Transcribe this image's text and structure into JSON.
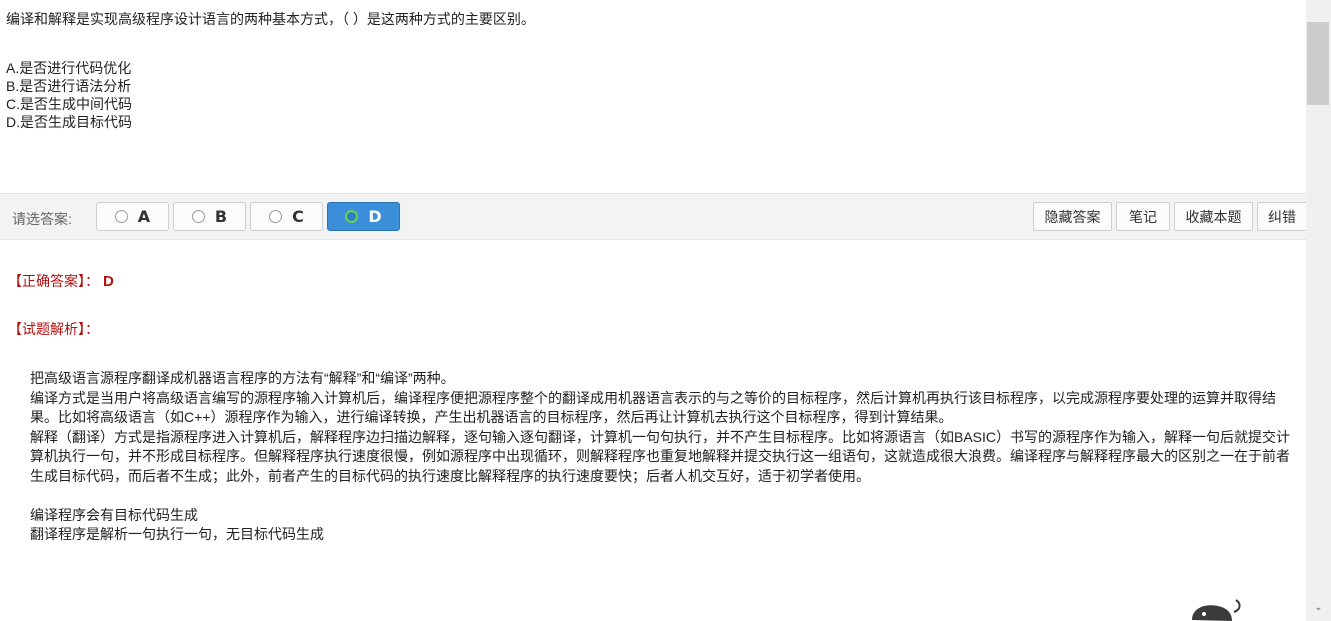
{
  "question": {
    "text": "编译和解释是实现高级程序设计语言的两种基本方式，（ ）是这两种方式的主要区别。",
    "options": [
      "A.是否进行代码优化",
      "B.是否进行语法分析",
      "C.是否生成中间代码",
      "D.是否生成目标代码"
    ]
  },
  "answer_bar": {
    "prompt": "请选答案:",
    "choices": [
      "A",
      "B",
      "C",
      "D"
    ],
    "selected": "D",
    "hide_answer": "隐藏答案",
    "notes": "笔记",
    "favorite": "收藏本题",
    "report_error": "纠错"
  },
  "result": {
    "correct_label": "【正确答案】：",
    "correct_value": "D",
    "analysis_label": "【试题解析】："
  },
  "analysis": {
    "p1": "把高级语言源程序翻译成机器语言程序的方法有“解释”和“编译”两种。",
    "p2": "编译方式是当用户将高级语言编写的源程序输入计算机后，编译程序便把源程序整个的翻译成用机器语言表示的与之等价的目标程序，然后计算机再执行该目标程序，以完成源程序要处理的运算并取得结果。比如将高级语言（如C++）源程序作为输入，进行编译转换，产生出机器语言的目标程序，然后再让计算机去执行这个目标程序，得到计算结果。",
    "p3": "解释（翻译）方式是指源程序进入计算机后，解释程序边扫描边解释，逐句输入逐句翻译，计算机一句句执行，并不产生目标程序。比如将源语言（如BASIC）书写的源程序作为输入，解释一句后就提交计算机执行一句，并不形成目标程序。但解释程序执行速度很慢，例如源程序中出现循环，则解释程序也重复地解释并提交执行这一组语句，这就造成很大浪费。编译程序与解释程序最大的区别之一在于前者生成目标代码，而后者不生成；此外，前者产生的目标代码的执行速度比解释程序的执行速度要快；后者人机交互好，适于初学者使用。",
    "p4": "编译程序会有目标代码生成",
    "p5": "翻译程序是解析一句执行一句，无目标代码生成"
  },
  "colors": {
    "accent": "#3b8fd8",
    "answer_red": "#b31212",
    "bar_bg": "#f3f3f3"
  }
}
